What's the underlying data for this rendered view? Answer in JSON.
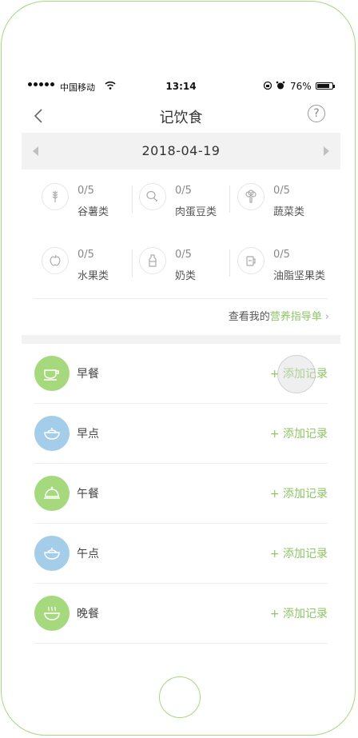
{
  "status_bar": {
    "carrier": "中国移动",
    "time": "13:14",
    "battery": "76%",
    "battery_level": 0.76
  },
  "nav": {
    "title": "记饮食",
    "help_label": "?"
  },
  "date_bar": {
    "date": "2018-04-19"
  },
  "food_groups": [
    {
      "count": "0/5",
      "label": "谷薯类",
      "icon": "grain-icon"
    },
    {
      "count": "0/5",
      "label": "肉蛋豆类",
      "icon": "meat-drumstick-icon"
    },
    {
      "count": "0/5",
      "label": "蔬菜类",
      "icon": "vegetable-icon"
    },
    {
      "count": "0/5",
      "label": "水果类",
      "icon": "apple-icon"
    },
    {
      "count": "0/5",
      "label": "奶类",
      "icon": "milk-bottle-icon"
    },
    {
      "count": "0/5",
      "label": "油脂坚果类",
      "icon": "oil-jar-icon"
    }
  ],
  "guide_link": {
    "prefix": "查看我的",
    "highlight": "营养指导单",
    "chevron": "›"
  },
  "meals": [
    {
      "name": "早餐",
      "add_label": "+ 添加记录",
      "icon": "cup-icon",
      "color": "#a6d97e"
    },
    {
      "name": "早点",
      "add_label": "+ 添加记录",
      "icon": "bowl-icon",
      "color": "#a3cde9"
    },
    {
      "name": "午餐",
      "add_label": "+ 添加记录",
      "icon": "cloche-icon",
      "color": "#a6d97e"
    },
    {
      "name": "午点",
      "add_label": "+ 添加记录",
      "icon": "bowl-icon",
      "color": "#a3cde9"
    },
    {
      "name": "晚餐",
      "add_label": "+ 添加记录",
      "icon": "hot-bowl-icon",
      "color": "#a6d97e"
    }
  ],
  "colors": {
    "accent_green": "#8cc665",
    "frame_green": "#a6d97e",
    "light_blue": "#a3cde9"
  }
}
